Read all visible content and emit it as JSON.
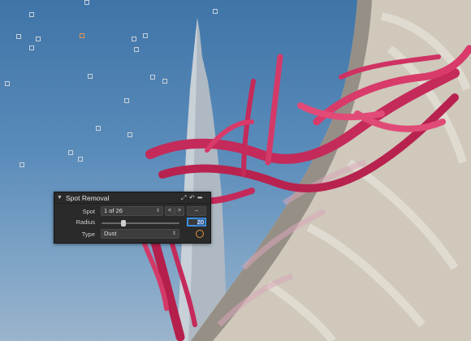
{
  "panel": {
    "title": "Spot Removal",
    "spot_label": "Spot",
    "spot_value": "1 of 26",
    "prev_label": "<",
    "next_label": ">",
    "spot_extra": "–",
    "radius_label": "Radius",
    "radius_value": "20",
    "radius_slider_fraction": 0.28,
    "type_label": "Type",
    "type_value": "Dust"
  },
  "icons": {
    "collapse": "chevron-down-icon",
    "reset": "reset-icon",
    "undo": "undo-icon",
    "more": "more-icon",
    "type_indicator": "circle-icon"
  },
  "colors": {
    "accent": "#3b8fe0",
    "spot_active": "#e6974a",
    "sculpture": "#c42a5a"
  }
}
